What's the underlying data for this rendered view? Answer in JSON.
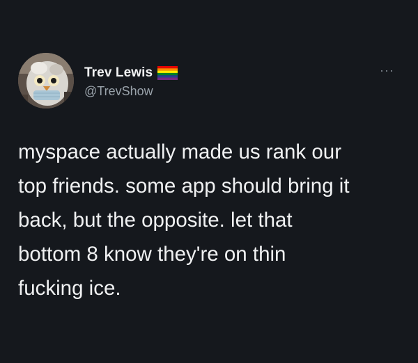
{
  "author": {
    "display_name": "Trev Lewis",
    "handle": "@TrevShow",
    "badge_icon": "pride-flag-icon",
    "avatar_icon": "furby-avatar-icon"
  },
  "menu": {
    "more_icon": "more-options-icon",
    "more_glyph": "···"
  },
  "tweet": {
    "lines": [
      "myspace actually made us rank our",
      "top friends. some app should bring it",
      "back, but the opposite. let that",
      "bottom 8 know they're on thin",
      "fucking ice."
    ]
  },
  "colors": {
    "background": "#15181d",
    "text": "#f0f1f2",
    "secondary_text": "#9aa3ab"
  }
}
